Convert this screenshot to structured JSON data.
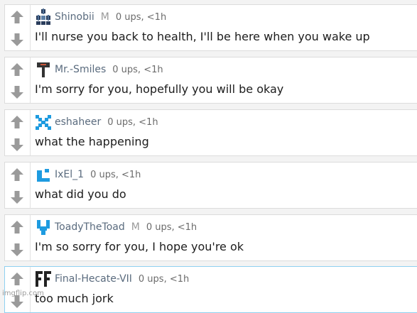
{
  "colors": {
    "background": "#f3f3f3",
    "card": "#ffffff",
    "username": "#5a6b7e",
    "text": "#1c1c1c",
    "arrow": "#9a9a9a",
    "highlight_border": "#8fd0f0"
  },
  "comments": [
    {
      "username": "Shinobii",
      "mod_badge": "M",
      "stats": "0 ups, <1h",
      "text": "I'll nurse you back to health, I'll be here when you wake up",
      "avatar_icon": "shuriken-cluster-icon"
    },
    {
      "username": "Mr.-Smiles",
      "mod_badge": "",
      "stats": "0 ups, <1h",
      "text": "I'm sorry for you, hopefully you will be okay",
      "avatar_icon": "signpost-icon"
    },
    {
      "username": "eshaheer",
      "mod_badge": "",
      "stats": "0 ups, <1h",
      "text": "what the happening",
      "avatar_icon": "blue-pixel-x-icon"
    },
    {
      "username": "IxEl_1",
      "mod_badge": "",
      "stats": "0 ups, <1h",
      "text": "what did you do",
      "avatar_icon": "blue-pixel-bracket-icon"
    },
    {
      "username": "ToadyTheToad",
      "mod_badge": "M",
      "stats": "0 ups, <1h",
      "text": "I'm so sorry for you, I hope you're ok",
      "avatar_icon": "blue-pixel-cup-icon"
    },
    {
      "username": "Final-Hecate-VII",
      "mod_badge": "",
      "stats": "0 ups, <1h",
      "text": "too much jork",
      "avatar_icon": "ff-letters-icon",
      "highlighted": true
    }
  ],
  "watermark": "imgflip.com"
}
